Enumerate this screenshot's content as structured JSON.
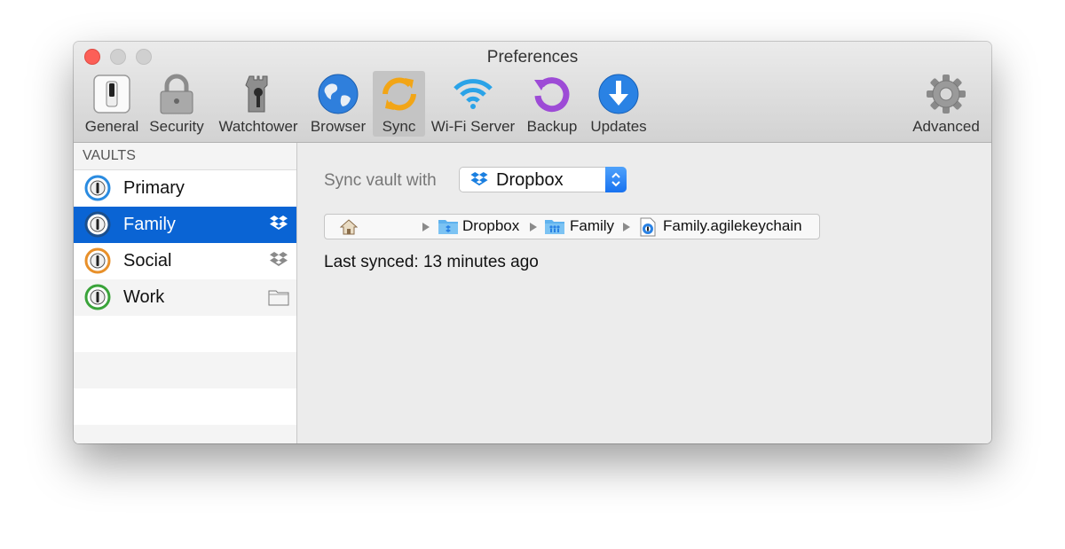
{
  "window": {
    "title": "Preferences"
  },
  "toolbar": {
    "items": [
      {
        "label": "General",
        "icon": "switch-icon"
      },
      {
        "label": "Security",
        "icon": "padlock-icon"
      },
      {
        "label": "Watchtower",
        "icon": "watchtower-icon"
      },
      {
        "label": "Browser",
        "icon": "globe-icon"
      },
      {
        "label": "Sync",
        "icon": "sync-arrows-icon",
        "selected": true
      },
      {
        "label": "Wi-Fi Server",
        "icon": "wifi-icon"
      },
      {
        "label": "Backup",
        "icon": "backup-icon"
      },
      {
        "label": "Updates",
        "icon": "download-arrow-icon"
      },
      {
        "label": "Advanced",
        "icon": "gear-icon"
      }
    ]
  },
  "sidebar": {
    "header": "VAULTS",
    "vaults": [
      {
        "name": "Primary",
        "color": "#2a8be0",
        "badge": ""
      },
      {
        "name": "Family",
        "color": "#1c4f8c",
        "badge": "dropbox-icon",
        "selected": true
      },
      {
        "name": "Social",
        "color": "#e8902a",
        "badge": "dropbox-icon"
      },
      {
        "name": "Work",
        "color": "#3aa33a",
        "badge": "folder-icon"
      }
    ]
  },
  "main": {
    "sync_label": "Sync vault with",
    "sync_option": "Dropbox",
    "path": [
      "Dropbox",
      "Family",
      "Family.agilekeychain"
    ],
    "last_synced": "Last synced: 13 minutes ago"
  },
  "colors": {
    "selection": "#0a64d4",
    "close": "#fc5f57",
    "stepper": "#1872f0"
  }
}
